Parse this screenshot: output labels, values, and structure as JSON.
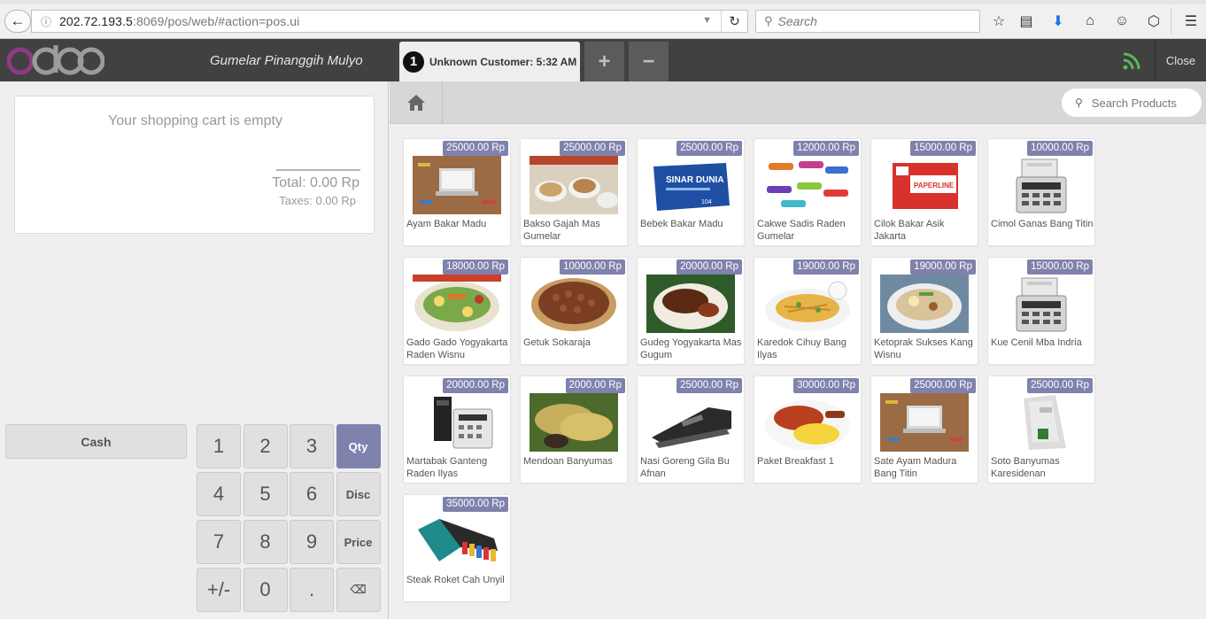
{
  "browser": {
    "url_host": "202.72.193.5",
    "url_rest": ":8069/pos/web/#action=pos.ui",
    "search_placeholder": "Search"
  },
  "topbar": {
    "logo_text": "odoo",
    "shop_name": "Gumelar Pinanggih Mulyo",
    "order_number": "1",
    "order_label": "Unknown Customer: 5:32 AM",
    "add_label": "+",
    "remove_label": "−",
    "close_label": "Close"
  },
  "cart": {
    "empty_message": "Your shopping cart is empty",
    "total": "Total: 0.00 Rp",
    "taxes": "Taxes: 0.00 Rp"
  },
  "payment": {
    "cash_label": "Cash"
  },
  "numpad": {
    "keys": [
      "1",
      "2",
      "3",
      "Qty",
      "4",
      "5",
      "6",
      "Disc",
      "7",
      "8",
      "9",
      "Price",
      "+/-",
      "0",
      ".",
      "⌫"
    ],
    "active_mode": "Qty"
  },
  "search_products": {
    "placeholder": "Search Products"
  },
  "colors": {
    "accent": "#7f82ac",
    "topbar": "#414141",
    "logo_purple": "#8f3a82"
  },
  "products": [
    {
      "name": "Ayam Bakar Madu",
      "price": "25000.00 Rp",
      "image": "laptop-desk"
    },
    {
      "name": "Bakso Gajah Mas Gumelar",
      "price": "25000.00 Rp",
      "image": "food-bowls"
    },
    {
      "name": "Bebek Bakar Madu",
      "price": "25000.00 Rp",
      "image": "paper-box"
    },
    {
      "name": "Cakwe Sadis Raden Gumelar",
      "price": "12000.00 Rp",
      "image": "staplers"
    },
    {
      "name": "Cilok Bakar Asik Jakarta",
      "price": "15000.00 Rp",
      "image": "envelope-box"
    },
    {
      "name": "Cimol Ganas Bang Titin",
      "price": "10000.00 Rp",
      "image": "calculator"
    },
    {
      "name": "Gado Gado Yogyakarta Raden Wisnu",
      "price": "18000.00 Rp",
      "image": "salad-plate"
    },
    {
      "name": "Getuk Sokaraja",
      "price": "10000.00 Rp",
      "image": "snack-basket"
    },
    {
      "name": "Gudeg Yogyakarta Mas Gugum",
      "price": "20000.00 Rp",
      "image": "rice-meat"
    },
    {
      "name": "Karedok Cihuy Bang Ilyas",
      "price": "19000.00 Rp",
      "image": "noodle-plate"
    },
    {
      "name": "Ketoprak Sukses Kang Wisnu",
      "price": "19000.00 Rp",
      "image": "rice-bowl"
    },
    {
      "name": "Kue Cenil Mba Indria",
      "price": "15000.00 Rp",
      "image": "calculator"
    },
    {
      "name": "Martabak Ganteng Raden Ilyas",
      "price": "20000.00 Rp",
      "image": "calculator-dark"
    },
    {
      "name": "Mendoan Banyumas",
      "price": "2000.00 Rp",
      "image": "fried-tempeh"
    },
    {
      "name": "Nasi Goreng Gila Bu Afnan",
      "price": "25000.00 Rp",
      "image": "stapler-black"
    },
    {
      "name": "Paket Breakfast 1",
      "price": "30000.00 Rp",
      "image": "breakfast-plate"
    },
    {
      "name": "Sate Ayam Madura Bang Titin",
      "price": "25000.00 Rp",
      "image": "laptop-desk"
    },
    {
      "name": "Soto Banyumas Karesidenan",
      "price": "25000.00 Rp",
      "image": "fingerprint-device"
    },
    {
      "name": "Steak Roket Cah Unyil",
      "price": "35000.00 Rp",
      "image": "file-organizer"
    }
  ]
}
